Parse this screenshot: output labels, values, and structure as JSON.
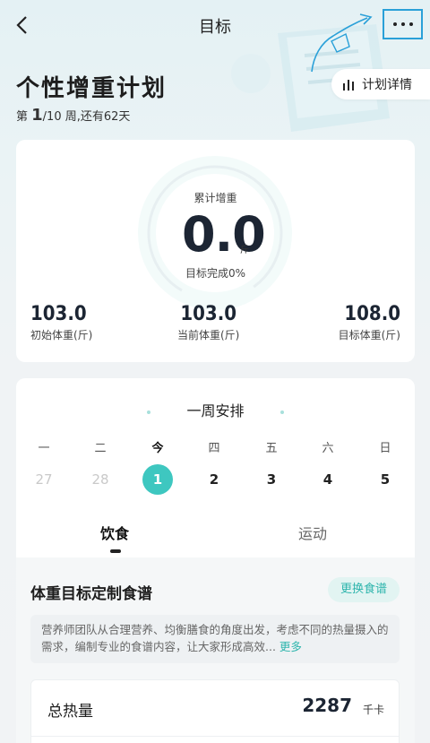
{
  "nav": {
    "title": "目标"
  },
  "plan": {
    "title": "个性增重计划",
    "week_prefix": "第 ",
    "week_current": "1",
    "week_rest": "/10 周,还有62天",
    "detail_label": "计划详情"
  },
  "progress_card": {
    "label": "累计增重",
    "value": "0.0",
    "unit": "斤",
    "completion": "目标完成0%",
    "completion_fraction": 0,
    "stats": [
      {
        "value": "103.0",
        "label": "初始体重(斤)"
      },
      {
        "value": "103.0",
        "label": "当前体重(斤)"
      },
      {
        "value": "108.0",
        "label": "目标体重(斤)"
      }
    ]
  },
  "week": {
    "title": "一周安排",
    "weekdays": [
      "一",
      "二",
      "今",
      "四",
      "五",
      "六",
      "日"
    ],
    "days": [
      "27",
      "28",
      "1",
      "2",
      "3",
      "4",
      "5"
    ]
  },
  "tabs": {
    "diet": "饮食",
    "sport": "运动"
  },
  "diet": {
    "title": "体重目标定制食谱",
    "change_label": "更换食谱",
    "description": "营养师团队从合理营养、均衡膳食的角度出发，考虑不同的热量摄入的需求，编制专业的食谱内容，让大家形成高效...",
    "more_label": "更多",
    "calorie_label": "总热量",
    "calorie_value": "2287",
    "calorie_unit": "千卡"
  },
  "colors": {
    "accent": "#3ec7c0",
    "annotation": "#2aa0d8"
  }
}
